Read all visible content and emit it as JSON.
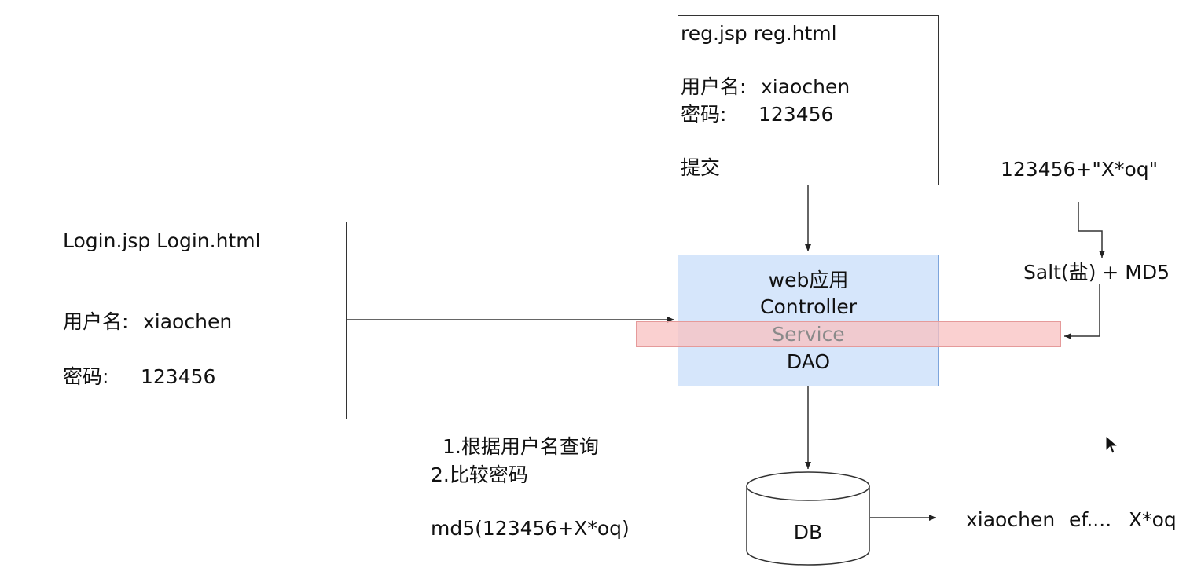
{
  "reg_box": {
    "title": "reg.jsp reg.html",
    "username_label": "用户名:",
    "username_value": "xiaochen",
    "password_label": "密码:",
    "password_value": "123456",
    "submit_label": "提交"
  },
  "login_box": {
    "title": "Login.jsp Login.html",
    "username_label": "用户名:",
    "username_value": "xiaochen",
    "password_label": "密码:",
    "password_value": "123456"
  },
  "web_app": {
    "title": "web应用",
    "layers": [
      "Controller",
      "Service",
      "DAO"
    ]
  },
  "salt_flow": {
    "input": "123456+\"X*oq\"",
    "method": "Salt(盐) + MD5"
  },
  "login_steps": {
    "step1": "1.根据用户名查询",
    "step2": "2.比较密码",
    "formula": "md5(123456+X*oq)"
  },
  "database": {
    "label": "DB",
    "record": {
      "username": "xiaochen",
      "hash": "ef....",
      "salt": "X*oq"
    }
  },
  "colors": {
    "web_app_fill": "#d6e6fb",
    "web_app_border": "#7da5dc",
    "service_band_fill": "#f8c0c0",
    "service_text": "#8a8a8a",
    "line": "#333333"
  }
}
